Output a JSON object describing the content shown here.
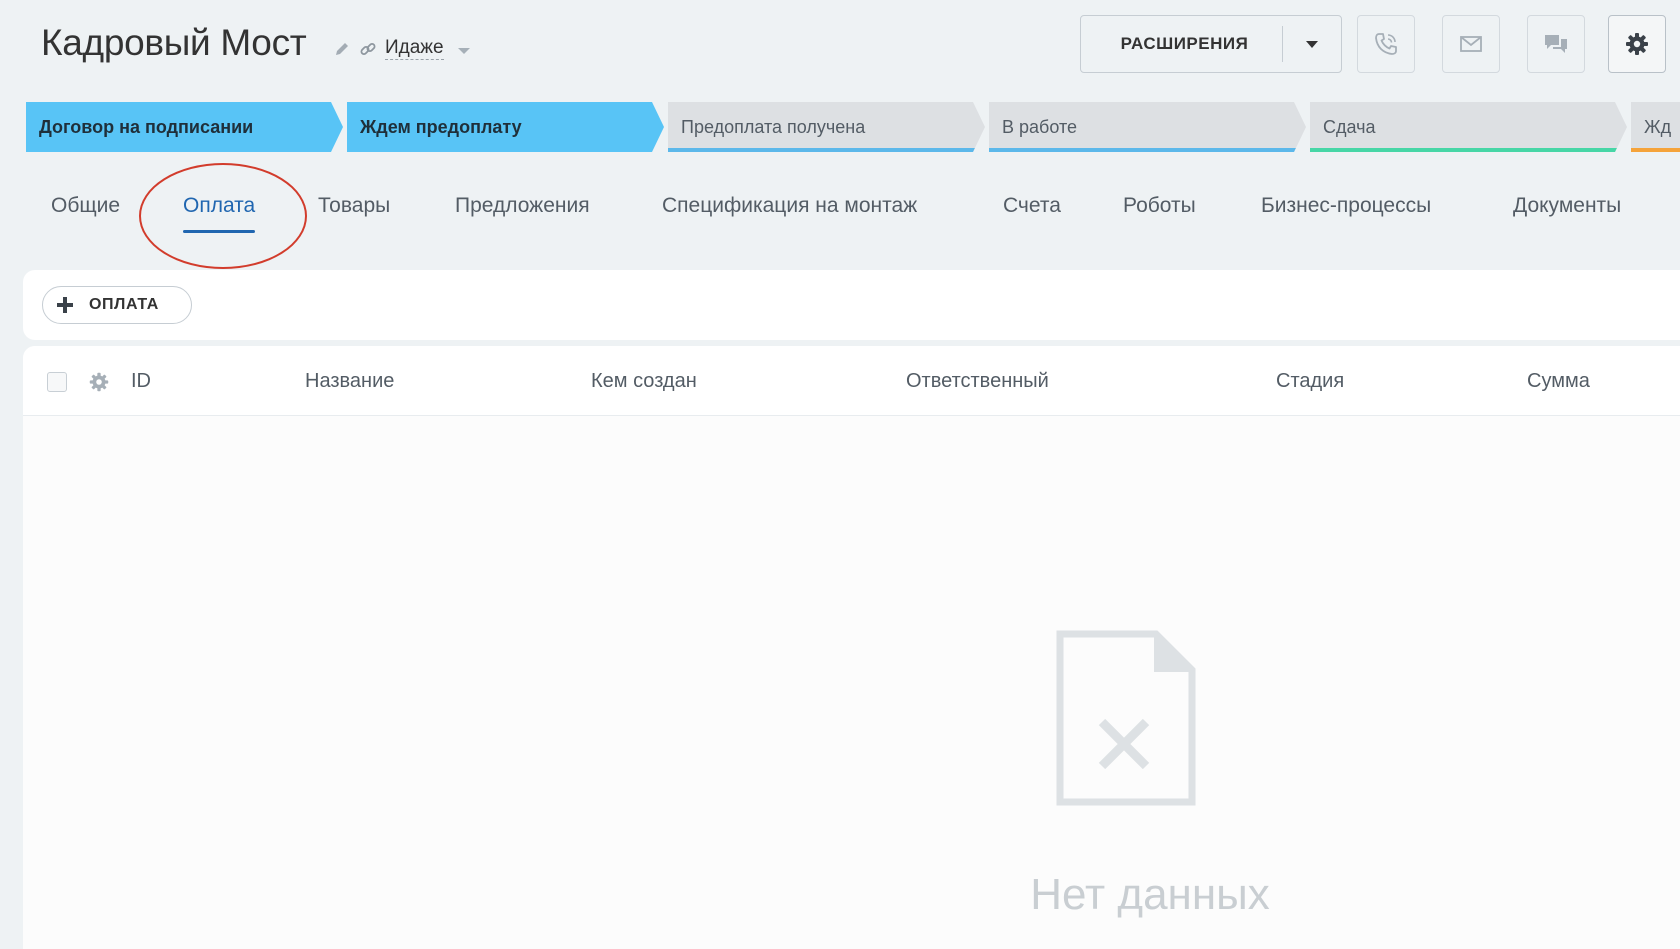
{
  "header": {
    "title": "Кадровый Мост",
    "link_text": "Идаже",
    "extensions_label": "РАСШИРЕНИЯ"
  },
  "stages": [
    {
      "label": "Договор на подписании",
      "state": "active",
      "color": "#58c4f6"
    },
    {
      "label": "Ждем предоплату",
      "state": "active",
      "color": "#58c4f6"
    },
    {
      "label": "Предоплата получена",
      "state": "inactive",
      "color": "#5cb8ea"
    },
    {
      "label": "В работе",
      "state": "inactive",
      "color": "#5cb8ea"
    },
    {
      "label": "Сдача",
      "state": "inactive",
      "color": "#47d6a6"
    },
    {
      "label": "Жд",
      "state": "inactive",
      "color": "#f5a33a"
    }
  ],
  "tabs": [
    {
      "label": "Общие"
    },
    {
      "label": "Оплата",
      "active": true
    },
    {
      "label": "Товары"
    },
    {
      "label": "Предложения"
    },
    {
      "label": "Спецификация на монтаж"
    },
    {
      "label": "Счета"
    },
    {
      "label": "Роботы"
    },
    {
      "label": "Бизнес-процессы"
    },
    {
      "label": "Документы"
    }
  ],
  "toolbar": {
    "add_label": "ОПЛАТА"
  },
  "grid": {
    "columns": [
      "ID",
      "Название",
      "Кем создан",
      "Ответственный",
      "Стадия",
      "Сумма"
    ],
    "empty_text": "Нет данных"
  },
  "colors": {
    "accent": "#2066b0",
    "annotation": "#d23c2c"
  }
}
